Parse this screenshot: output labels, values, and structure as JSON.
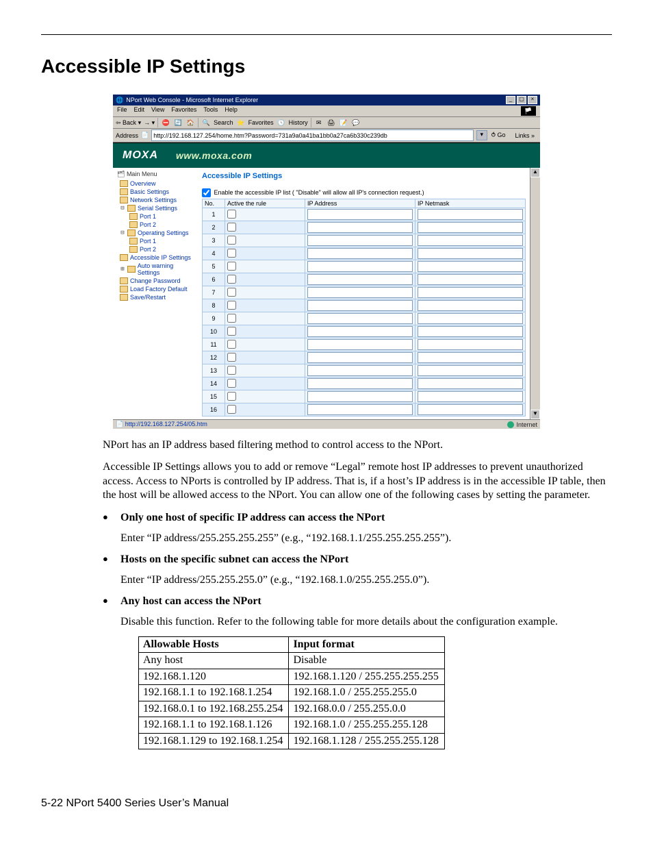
{
  "heading": "Accessible IP Settings",
  "screenshot": {
    "window_title": "NPort Web Console - Microsoft Internet Explorer",
    "menus": [
      "File",
      "Edit",
      "View",
      "Favorites",
      "Tools",
      "Help"
    ],
    "toolbar": {
      "back": "Back",
      "search": "Search",
      "favorites": "Favorites",
      "history": "History"
    },
    "address_label": "Address",
    "address_value": "http://192.168.127.254/home.htm?Password=731a9a0a41ba1bb0a27ca6b330c239db",
    "go_label": "Go",
    "links_label": "Links",
    "brand": "MOXA",
    "brand_url": "www.moxa.com",
    "sidebar_header": "Main Menu",
    "sidebar": [
      "Overview",
      "Basic Settings",
      "Network Settings",
      "Serial Settings",
      "Port 1",
      "Port 2",
      "Operating Settings",
      "Port 1",
      "Port 2",
      "Accessible IP Settings",
      "Auto warning Settings",
      "Change Password",
      "Load Factory Default",
      "Save/Restart"
    ],
    "content_title": "Accessible IP Settings",
    "enable_label": "Enable the accessible IP list ( \"Disable\" will allow all IP's connection request.)",
    "cols": {
      "no": "No.",
      "active": "Active the rule",
      "ip": "IP Address",
      "mask": "IP Netmask"
    },
    "rows": [
      1,
      2,
      3,
      4,
      5,
      6,
      7,
      8,
      9,
      10,
      11,
      12,
      13,
      14,
      15,
      16
    ],
    "status_url": "http://192.168.127.254/05.htm",
    "status_zone": "Internet"
  },
  "para1": "NPort has an IP address based filtering method to control access to the NPort.",
  "para2": "Accessible IP Settings allows you to add or remove “Legal” remote host IP addresses to prevent unauthorized access. Access to NPorts is controlled by IP address. That is, if a host’s IP address is in the accessible IP table, then the host will be allowed access to the NPort. You can allow one of the following cases by setting the parameter.",
  "cases": [
    {
      "title": "Only one host of specific IP address can access the NPort",
      "desc": "Enter “IP address/255.255.255.255” (e.g., “192.168.1.1/255.255.255.255”)."
    },
    {
      "title": "Hosts on the specific subnet can access the NPort",
      "desc": "Enter “IP address/255.255.255.0” (e.g., “192.168.1.0/255.255.255.0”)."
    },
    {
      "title": "Any host can access the NPort",
      "desc": "Disable this function. Refer to the following table for more details about the configuration example."
    }
  ],
  "table_head": {
    "hosts": "Allowable Hosts",
    "format": "Input format"
  },
  "table_rows": [
    {
      "hosts": "Any host",
      "format": "Disable"
    },
    {
      "hosts": "192.168.1.120",
      "format": "192.168.1.120 / 255.255.255.255"
    },
    {
      "hosts": "192.168.1.1 to 192.168.1.254",
      "format": "192.168.1.0 / 255.255.255.0"
    },
    {
      "hosts": "192.168.0.1 to 192.168.255.254",
      "format": "192.168.0.0 / 255.255.0.0"
    },
    {
      "hosts": "192.168.1.1 to 192.168.1.126",
      "format": "192.168.1.0 / 255.255.255.128"
    },
    {
      "hosts": "192.168.1.129 to 192.168.1.254",
      "format": "192.168.1.128 / 255.255.255.128"
    }
  ],
  "footer": "5-22  NPort 5400 Series User’s Manual"
}
